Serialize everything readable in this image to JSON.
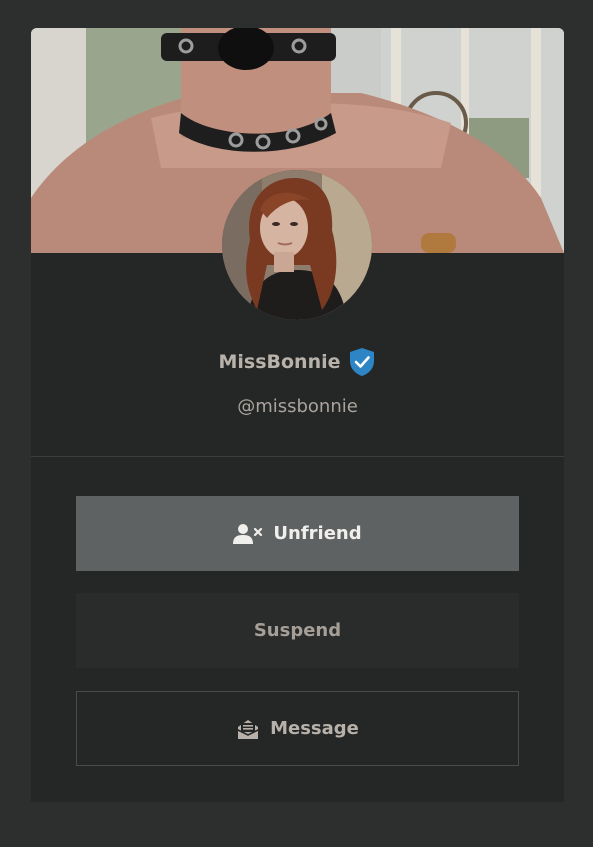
{
  "profile": {
    "display_name": "MissBonnie",
    "handle": "@missbonnie",
    "verified": true
  },
  "actions": {
    "unfriend_label": "Unfriend",
    "suspend_label": "Suspend",
    "message_label": "Message"
  },
  "icons": {
    "verified": "shield-check-icon",
    "unfriend": "user-x-icon",
    "message": "envelope-open-icon"
  },
  "colors": {
    "page_background": "#2d2e2e",
    "card_background": "#252626",
    "unfriend_button": "#5f6263",
    "verified_badge": "#2d85c5"
  }
}
